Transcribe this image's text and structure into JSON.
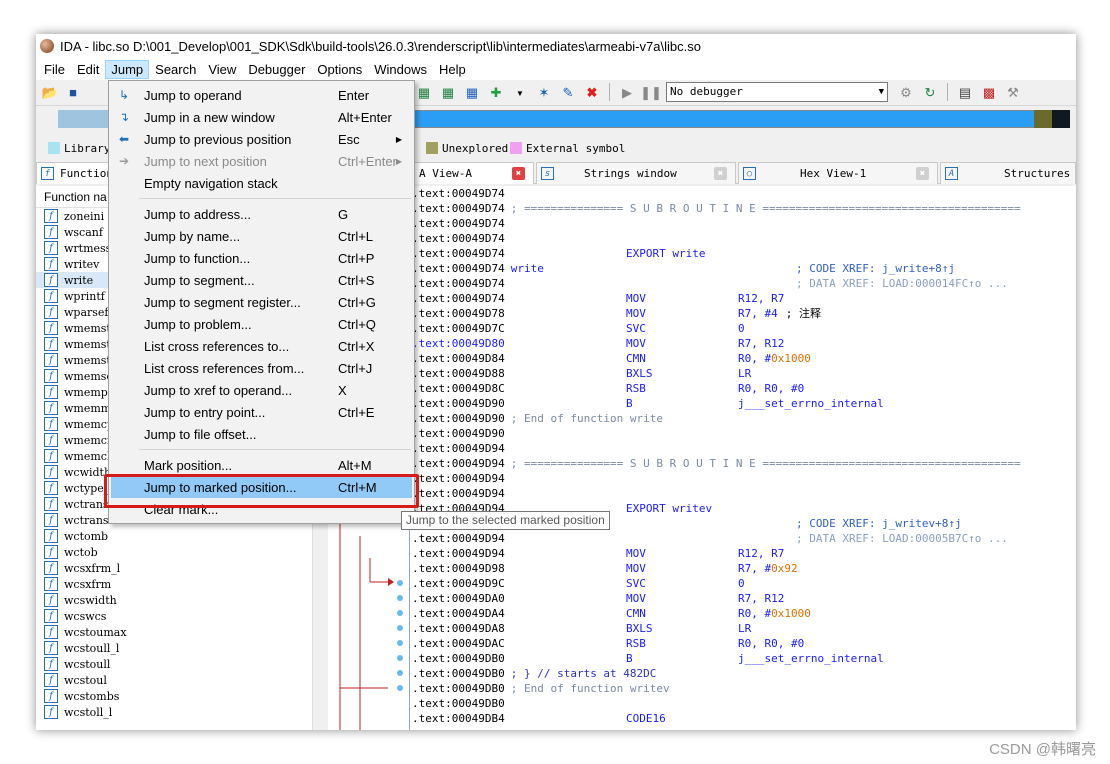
{
  "window": {
    "title": "IDA - libc.so D:\\001_Develop\\001_SDK\\Sdk\\build-tools\\26.0.3\\renderscript\\lib\\intermediates\\armeabi-v7a\\libc.so"
  },
  "menubar": {
    "items": [
      "File",
      "Edit",
      "Jump",
      "Search",
      "View",
      "Debugger",
      "Options",
      "Windows",
      "Help"
    ],
    "active": "Jump"
  },
  "toolbar": {
    "debugger_select": "No debugger"
  },
  "legend": {
    "items": [
      {
        "label": "Library",
        "color": "#a8e4f0"
      },
      {
        "label": "Unexplored",
        "color": "#a0a060"
      },
      {
        "label": "External symbol",
        "color": "#f0a0f0"
      }
    ]
  },
  "tabs": {
    "functions": "Function",
    "ida_view": "A View-A",
    "strings": "Strings window",
    "hex": "Hex View-1",
    "structures": "Structures"
  },
  "functions_panel": {
    "header": "Function na",
    "items": [
      "zoneini",
      "wscanf",
      "wrtmess",
      "writev",
      "write",
      "wprintf",
      "wparsef",
      "wmemstr",
      "wmemstr",
      "wmemstr",
      "wmemset",
      "wmempcp",
      "wmemmov",
      "wmemcpy",
      "wmemcmp",
      "wmemchr",
      "wcwidth",
      "wctype_l",
      "wctrans",
      "wctrans",
      "wctomb",
      "wctob",
      "wcsxfrm_l",
      "wcsxfrm",
      "wcswidth",
      "wcswcs",
      "wcstoumax",
      "wcstoull_l",
      "wcstoull",
      "wcstoul",
      "wcstombs",
      "wcstoll_l"
    ],
    "selected_index": 4
  },
  "disasm": {
    "lines": [
      {
        "addr": ".text:00049D74"
      },
      {
        "addr": ".text:00049D74",
        "comment": "; =============== S U B R O U T I N E ======================================="
      },
      {
        "addr": ".text:00049D74"
      },
      {
        "addr": ".text:00049D74"
      },
      {
        "addr": ".text:00049D74",
        "mnem": "EXPORT write"
      },
      {
        "addr": ".text:00049D74",
        "label": "write",
        "xref": "; CODE XREF: j_write+8↑j"
      },
      {
        "addr": ".text:00049D74",
        "xref_grey": "; DATA XREF: LOAD:000014FC↑o ..."
      },
      {
        "addr": ".text:00049D74",
        "mnem": "MOV",
        "ops": "R12, R7"
      },
      {
        "addr": ".text:00049D78",
        "mnem": "MOV",
        "ops": "R7, #4",
        "ops_comment": "; 注释"
      },
      {
        "addr": ".text:00049D7C",
        "mnem": "SVC",
        "ops": "0"
      },
      {
        "addr": ".text:00049D80",
        "blue": true,
        "mnem": "MOV",
        "ops": "R7, R12"
      },
      {
        "addr": ".text:00049D84",
        "mnem": "CMN",
        "ops": "R0, #",
        "ops_hex": "0x1000"
      },
      {
        "addr": ".text:00049D88",
        "mnem": "BXLS",
        "ops": "LR"
      },
      {
        "addr": ".text:00049D8C",
        "mnem": "RSB",
        "ops": "R0, R0, #0"
      },
      {
        "addr": ".text:00049D90",
        "mnem": "B",
        "ops": "j___set_errno_internal"
      },
      {
        "addr": ".text:00049D90",
        "comment": "; End of function write"
      },
      {
        "addr": ".text:00049D90"
      },
      {
        "addr": ".text:00049D94"
      },
      {
        "addr": ".text:00049D94",
        "comment": "; =============== S U B R O U T I N E ======================================="
      },
      {
        "addr": ".text:00049D94"
      },
      {
        "addr": ".text:00049D94"
      },
      {
        "addr": ".text:00049D94",
        "mnem": "EXPORT writev"
      },
      {
        "addr": ".text:00049D94",
        "label": "writev",
        "xref": "; CODE XREF: j_writev+8↑j"
      },
      {
        "addr": ".text:00049D94",
        "xref_grey": "; DATA XREF: LOAD:00005B7C↑o ..."
      },
      {
        "addr": ".text:00049D94",
        "mnem": "MOV",
        "ops": "R12, R7"
      },
      {
        "addr": ".text:00049D98",
        "mnem": "MOV",
        "ops": "R7, #",
        "ops_hex": "0x92"
      },
      {
        "addr": ".text:00049D9C",
        "mnem": "SVC",
        "ops": "0"
      },
      {
        "addr": ".text:00049DA0",
        "mnem": "MOV",
        "ops": "R7, R12"
      },
      {
        "addr": ".text:00049DA4",
        "mnem": "CMN",
        "ops": "R0, #",
        "ops_hex": "0x1000"
      },
      {
        "addr": ".text:00049DA8",
        "mnem": "BXLS",
        "ops": "LR"
      },
      {
        "addr": ".text:00049DAC",
        "mnem": "RSB",
        "ops": "R0, R0, #0"
      },
      {
        "addr": ".text:00049DB0",
        "mnem": "B",
        "ops": "j___set_errno_internal"
      },
      {
        "addr": ".text:00049DB0",
        "comment": "; } // starts at 482DC",
        "comment_blue": true
      },
      {
        "addr": ".text:00049DB0",
        "comment": "; End of function writev"
      },
      {
        "addr": ".text:00049DB0"
      },
      {
        "addr": ".text:00049DB4",
        "mnem": "CODE16"
      }
    ]
  },
  "jump_menu": {
    "items": [
      {
        "label": "Jump to operand",
        "shortcut": "Enter",
        "icon": "jump-operand-icon",
        "glyph": "↳"
      },
      {
        "label": "Jump in a new window",
        "shortcut": "Alt+Enter",
        "icon": "new-window-icon",
        "glyph": "↴"
      },
      {
        "label": "Jump to previous position",
        "shortcut": "Esc",
        "icon": "back-arrow-icon",
        "glyph": "⬅",
        "submenu": true
      },
      {
        "label": "Jump to next position",
        "shortcut": "Ctrl+Enter",
        "icon": "forward-arrow-icon",
        "glyph": "➔",
        "disabled": true,
        "submenu": true
      },
      {
        "label": "Empty navigation stack",
        "shortcut": ""
      },
      {
        "separator": true
      },
      {
        "label": "Jump to address...",
        "shortcut": "G"
      },
      {
        "label": "Jump by name...",
        "shortcut": "Ctrl+L"
      },
      {
        "label": "Jump to function...",
        "shortcut": "Ctrl+P"
      },
      {
        "label": "Jump to segment...",
        "shortcut": "Ctrl+S"
      },
      {
        "label": "Jump to segment register...",
        "shortcut": "Ctrl+G"
      },
      {
        "label": "Jump to problem...",
        "shortcut": "Ctrl+Q"
      },
      {
        "label": "List cross references to...",
        "shortcut": "Ctrl+X"
      },
      {
        "label": "List cross references from...",
        "shortcut": "Ctrl+J"
      },
      {
        "label": "Jump to xref to operand...",
        "shortcut": "X"
      },
      {
        "label": "Jump to entry point...",
        "shortcut": "Ctrl+E"
      },
      {
        "label": "Jump to file offset...",
        "shortcut": ""
      },
      {
        "separator": true
      },
      {
        "label": "Mark position...",
        "shortcut": "Alt+M"
      },
      {
        "label": "Jump to marked position...",
        "shortcut": "Ctrl+M",
        "highlighted": true
      },
      {
        "label": "Clear mark...",
        "shortcut": ""
      }
    ]
  },
  "tooltip": "Jump to the selected marked position",
  "watermark": "CSDN @韩曙亮"
}
